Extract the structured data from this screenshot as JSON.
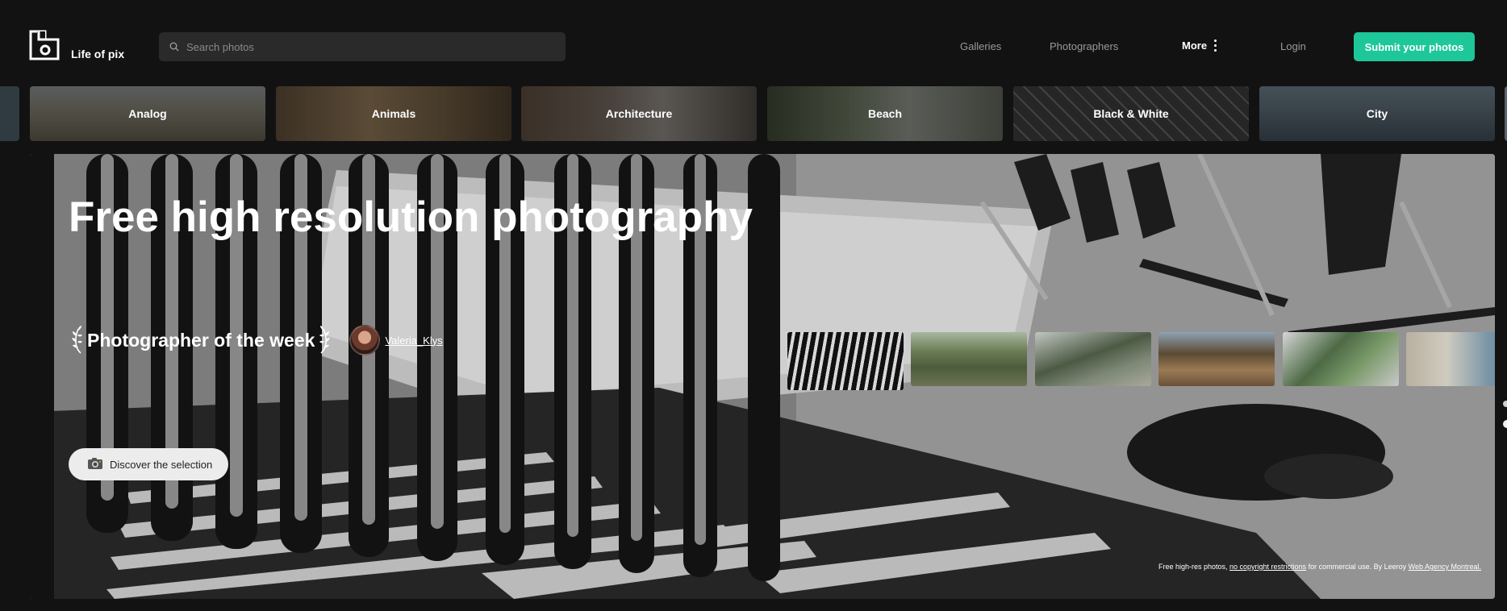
{
  "site": {
    "name": "Life of pix"
  },
  "search": {
    "placeholder": "Search photos",
    "value": ""
  },
  "nav": {
    "galleries": "Galleries",
    "photographers": "Photographers",
    "more": "More",
    "login": "Login",
    "submit": "Submit your photos"
  },
  "categories": [
    {
      "label": "Analog",
      "color": "#6d6a5e"
    },
    {
      "label": "Animals",
      "color": "#6b5a44"
    },
    {
      "label": "Architecture",
      "color": "#4c453f"
    },
    {
      "label": "Beach",
      "color": "#4e5245"
    },
    {
      "label": "Black & White",
      "color": "#474747"
    },
    {
      "label": "City",
      "color": "#4b5766"
    }
  ],
  "hero": {
    "title": "Free high resolution photography",
    "potw_title": "Photographer of the week",
    "photographer": "Valeria_Klys",
    "discover": "Discover the selection",
    "credit": {
      "part1": "Free high-res photos, ",
      "link1": "no copyright restrictions",
      "part2": " for commercial use. By Leeroy ",
      "link2": "Web Agency Montreal."
    }
  },
  "thumbnails": [
    {
      "name": "chair-shadow-bw",
      "color": "#3a3a3a"
    },
    {
      "name": "green-cabin",
      "color": "#5a6b4a"
    },
    {
      "name": "fallen-tree",
      "color": "#6f7768"
    },
    {
      "name": "seaweed-rocks",
      "color": "#7e6a4d"
    },
    {
      "name": "green-leaves",
      "color": "#5d7a56"
    },
    {
      "name": "tree-trunk-sea",
      "color": "#7a8a90"
    }
  ],
  "colors": {
    "accent": "#1ec79a",
    "background": "#121212"
  },
  "icons": [
    "logo-icon",
    "search-icon",
    "kebab-icon",
    "laurel-icon",
    "camera-icon"
  ]
}
